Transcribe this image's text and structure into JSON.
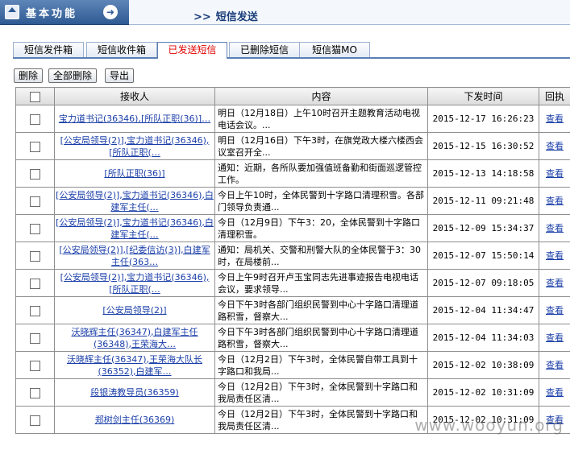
{
  "sidebar": {
    "title": "基本功能"
  },
  "header": {
    "chevrons": ">>",
    "title": "短信发送"
  },
  "tabs": [
    {
      "label": "短信发件箱"
    },
    {
      "label": "短信收件箱"
    },
    {
      "label": "已发送短信",
      "active": true
    },
    {
      "label": "已删除短信"
    },
    {
      "label": "短信猫MO"
    }
  ],
  "toolbar": {
    "delete_label": "删除",
    "delete_all_label": "全部删除",
    "export_label": "导出"
  },
  "table": {
    "headers": {
      "recipient": "接收人",
      "content": "内容",
      "time": "下发时间",
      "action": "回执"
    },
    "rows": [
      {
        "recipient": "宝力道书记(36346),[所队正职(36)]…",
        "content": "明日（12月18日）上午10时召开主题教育活动电视电话会议。...",
        "time": "2015-12-17 16:26:23",
        "action": "查看"
      },
      {
        "recipient": "[公安局领导(2)],宝力道书记(36346),[所队正职(…",
        "content": "明日（12月16日）下午3时，在旗党政大楼六楼西会议室召开全...",
        "time": "2015-12-15 16:30:52",
        "action": "查看"
      },
      {
        "recipient": "[所队正职(36)]",
        "content": "通知：近期，各所队要加强值班备勤和街面巡逻管控工作。",
        "time": "2015-12-13 14:18:58",
        "action": "查看"
      },
      {
        "recipient": "[公安局领导(2)],宝力道书记(36346),白建军主任(…",
        "content": "今日上午10时，全体民警到十字路口清理积雪。各部门领导负责通...",
        "time": "2015-12-11 09:21:48",
        "action": "查看"
      },
      {
        "recipient": "[公安局领导(2)],宝力道书记(36346),白建军主任(…",
        "content": "今日（12月9日）下午3：20，全体民警到十字路口清理积雪。",
        "time": "2015-12-09 15:34:37",
        "action": "查看"
      },
      {
        "recipient": "[公安局领导(2)],[纪委信访(3)],白建军主任(363…",
        "content": "通知：局机关、交警和刑警大队的全体民警于3：30时，在局楼前...",
        "time": "2015-12-07 15:50:14",
        "action": "查看"
      },
      {
        "recipient": "[公安局领导(2)],宝力道书记(36346),[所队正职(…",
        "content": "今日上午9时召开卢玉宝同志先进事迹报告电视电话会议，要求领导...",
        "time": "2015-12-07 09:18:05",
        "action": "查看"
      },
      {
        "recipient": "[公安局领导(2)]",
        "content": "今日下午3时各部门组织民警到中心十字路口清理道路积雪，督察大...",
        "time": "2015-12-04 11:34:47",
        "action": "查看"
      },
      {
        "recipient": "沃晓辉主任(36347),白建军主任(36348),王荣海大…",
        "content": "今日下午3时各部门组织民警到中心十字路口清理道路积雪，督察大...",
        "time": "2015-12-04 11:34:03",
        "action": "查看"
      },
      {
        "recipient": "沃晓辉主任(36347),王荣海大队长(36352),白建军…",
        "content": "今日（12月2日）下午3时，全体民警自带工具到十字路口和我局...",
        "time": "2015-12-02 10:38:09",
        "action": "查看"
      },
      {
        "recipient": "段银涛教导员(36359)",
        "content": "今日（12月2日）下午3时，全体民警到十字路口和我局责任区清...",
        "time": "2015-12-02 10:31:09",
        "action": "查看"
      },
      {
        "recipient": "郑树剑主任(36369)",
        "content": "今日（12月2日）下午3时，全体民警到十字路口和我局责任区清...",
        "time": "2015-12-02 10:31:09",
        "action": "查看"
      }
    ]
  },
  "watermark": "www.wooyun.org"
}
